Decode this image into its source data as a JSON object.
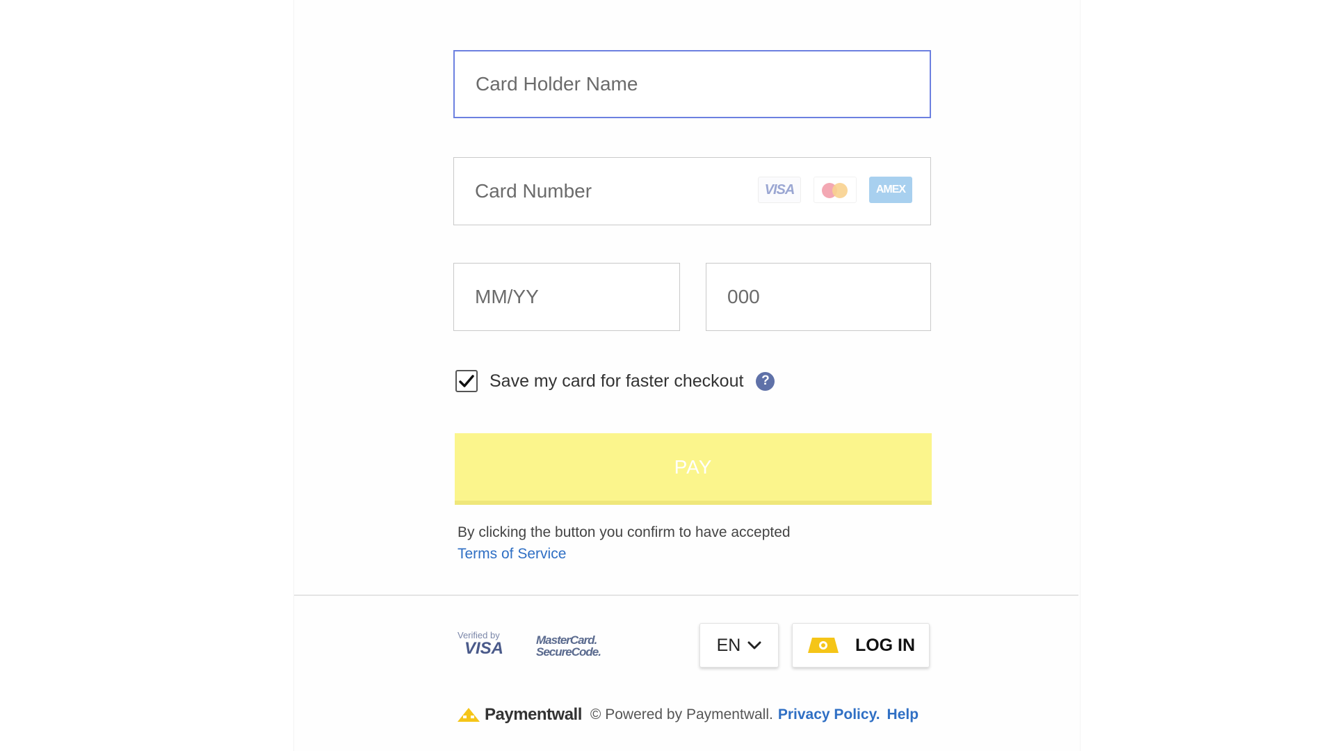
{
  "form": {
    "card_holder_placeholder": "Card Holder Name",
    "card_number_placeholder": "Card Number",
    "expiry_placeholder": "MM/YY",
    "cvv_placeholder": "000",
    "card_brands": [
      "VISA",
      "AMEX"
    ],
    "save_card_label": "Save my card for faster checkout",
    "save_card_checked": true,
    "help_symbol": "?",
    "pay_label": "PAY",
    "terms_text": "By clicking the button you confirm to have accepted",
    "terms_link": "Terms of Service"
  },
  "footer": {
    "verified_by_small": "Verified by",
    "verified_by_brand": "VISA",
    "mc_line1": "MasterCard.",
    "mc_line2": "SecureCode.",
    "language": "EN",
    "login_label": "LOG IN",
    "brand_name": "Paymentwall",
    "powered_text": "© Powered by Paymentwall.",
    "privacy_link": "Privacy Policy.",
    "help_link": "Help"
  },
  "colors": {
    "focus_border": "#6c80e0",
    "pay_button": "#fbf58c",
    "link": "#2f6fc4",
    "help_icon": "#5f71a8"
  },
  "icons": [
    "visa-logo-icon",
    "mastercard-logo-icon",
    "amex-logo-icon",
    "checkmark-icon",
    "help-icon",
    "chevron-down-icon",
    "login-icon",
    "paymentwall-logo-icon"
  ]
}
